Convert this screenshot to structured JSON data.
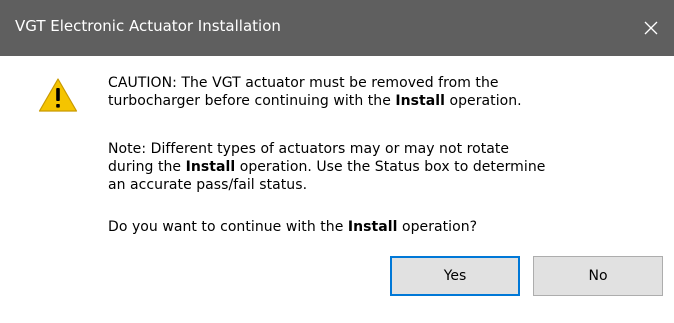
{
  "window": {
    "title": "VGT Electronic Actuator Installation",
    "close_icon": "close-icon"
  },
  "dialog": {
    "icon": "warning-icon",
    "caution": {
      "line1": "CAUTION: The VGT actuator must be removed from the",
      "line2_pre": "turbocharger before continuing with the ",
      "line2_bold": "Install",
      "line2_post": " operation."
    },
    "note": {
      "line1": "Note:  Different types of actuators may or may not rotate",
      "line2_pre": "during the ",
      "line2_bold": "Install",
      "line2_post": " operation.  Use the Status box to determine",
      "line3": "an accurate pass/fail status."
    },
    "question": {
      "pre": "Do you want to continue with the ",
      "bold": "Install",
      "post": " operation?"
    }
  },
  "buttons": {
    "yes": "Yes",
    "no": "No"
  },
  "colors": {
    "titlebar": "#5f5f5f",
    "focus_border": "#0078d7",
    "warning_yellow": "#f5c400"
  }
}
